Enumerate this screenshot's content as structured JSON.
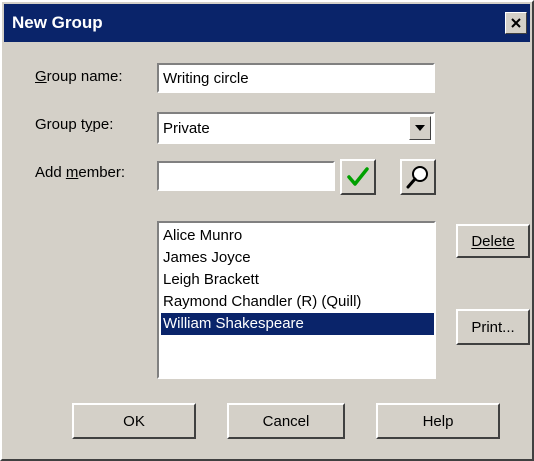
{
  "window": {
    "title": "New Group"
  },
  "form": {
    "group_name_label": "Group name:",
    "group_name_value": "Writing circle",
    "group_type_label": "Group type:",
    "group_type_value": "Private",
    "add_member_label": "Add member:",
    "add_member_value": ""
  },
  "members": [
    {
      "name": "Alice Munro",
      "selected": false
    },
    {
      "name": "James Joyce",
      "selected": false
    },
    {
      "name": "Leigh Brackett",
      "selected": false
    },
    {
      "name": "Raymond Chandler (R) (Quill)",
      "selected": false
    },
    {
      "name": "William Shakespeare",
      "selected": true
    }
  ],
  "buttons": {
    "delete": "Delete",
    "print": "Print...",
    "ok": "OK",
    "cancel": "Cancel",
    "help": "Help"
  },
  "colors": {
    "titlebar": "#0a246a",
    "face": "#d4d0c8",
    "selection": "#0a246a",
    "check": "#00a000"
  }
}
